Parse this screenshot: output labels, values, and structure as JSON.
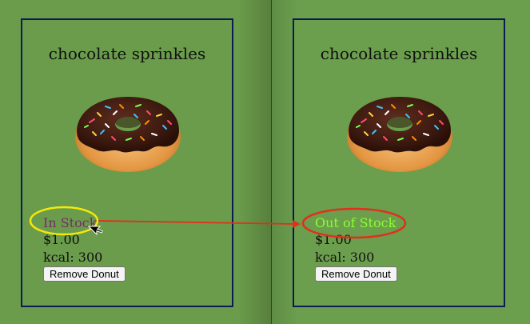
{
  "cards": [
    {
      "title": "chocolate sprinkles",
      "stock_status": "In Stock",
      "price": "$1.00",
      "kcal": "kcal: 300",
      "remove_button": "Remove Donut"
    },
    {
      "title": "chocolate sprinkles",
      "stock_status": "Out of Stock",
      "price": "$1.00",
      "kcal": "kcal: 300",
      "remove_button": "Remove Donut"
    }
  ],
  "colors": {
    "background": "#6b9e4d",
    "card_border": "#0d1a55",
    "in_stock_text": "#7a2a6a",
    "out_of_stock_text": "#8bff2e",
    "highlight_yellow": "#f5e90a",
    "highlight_red": "#e0301b",
    "arrow": "#e0301b"
  },
  "icons": {
    "donut_image": "chocolate-sprinkle-donut",
    "cursor": "mouse-pointer-icon"
  }
}
